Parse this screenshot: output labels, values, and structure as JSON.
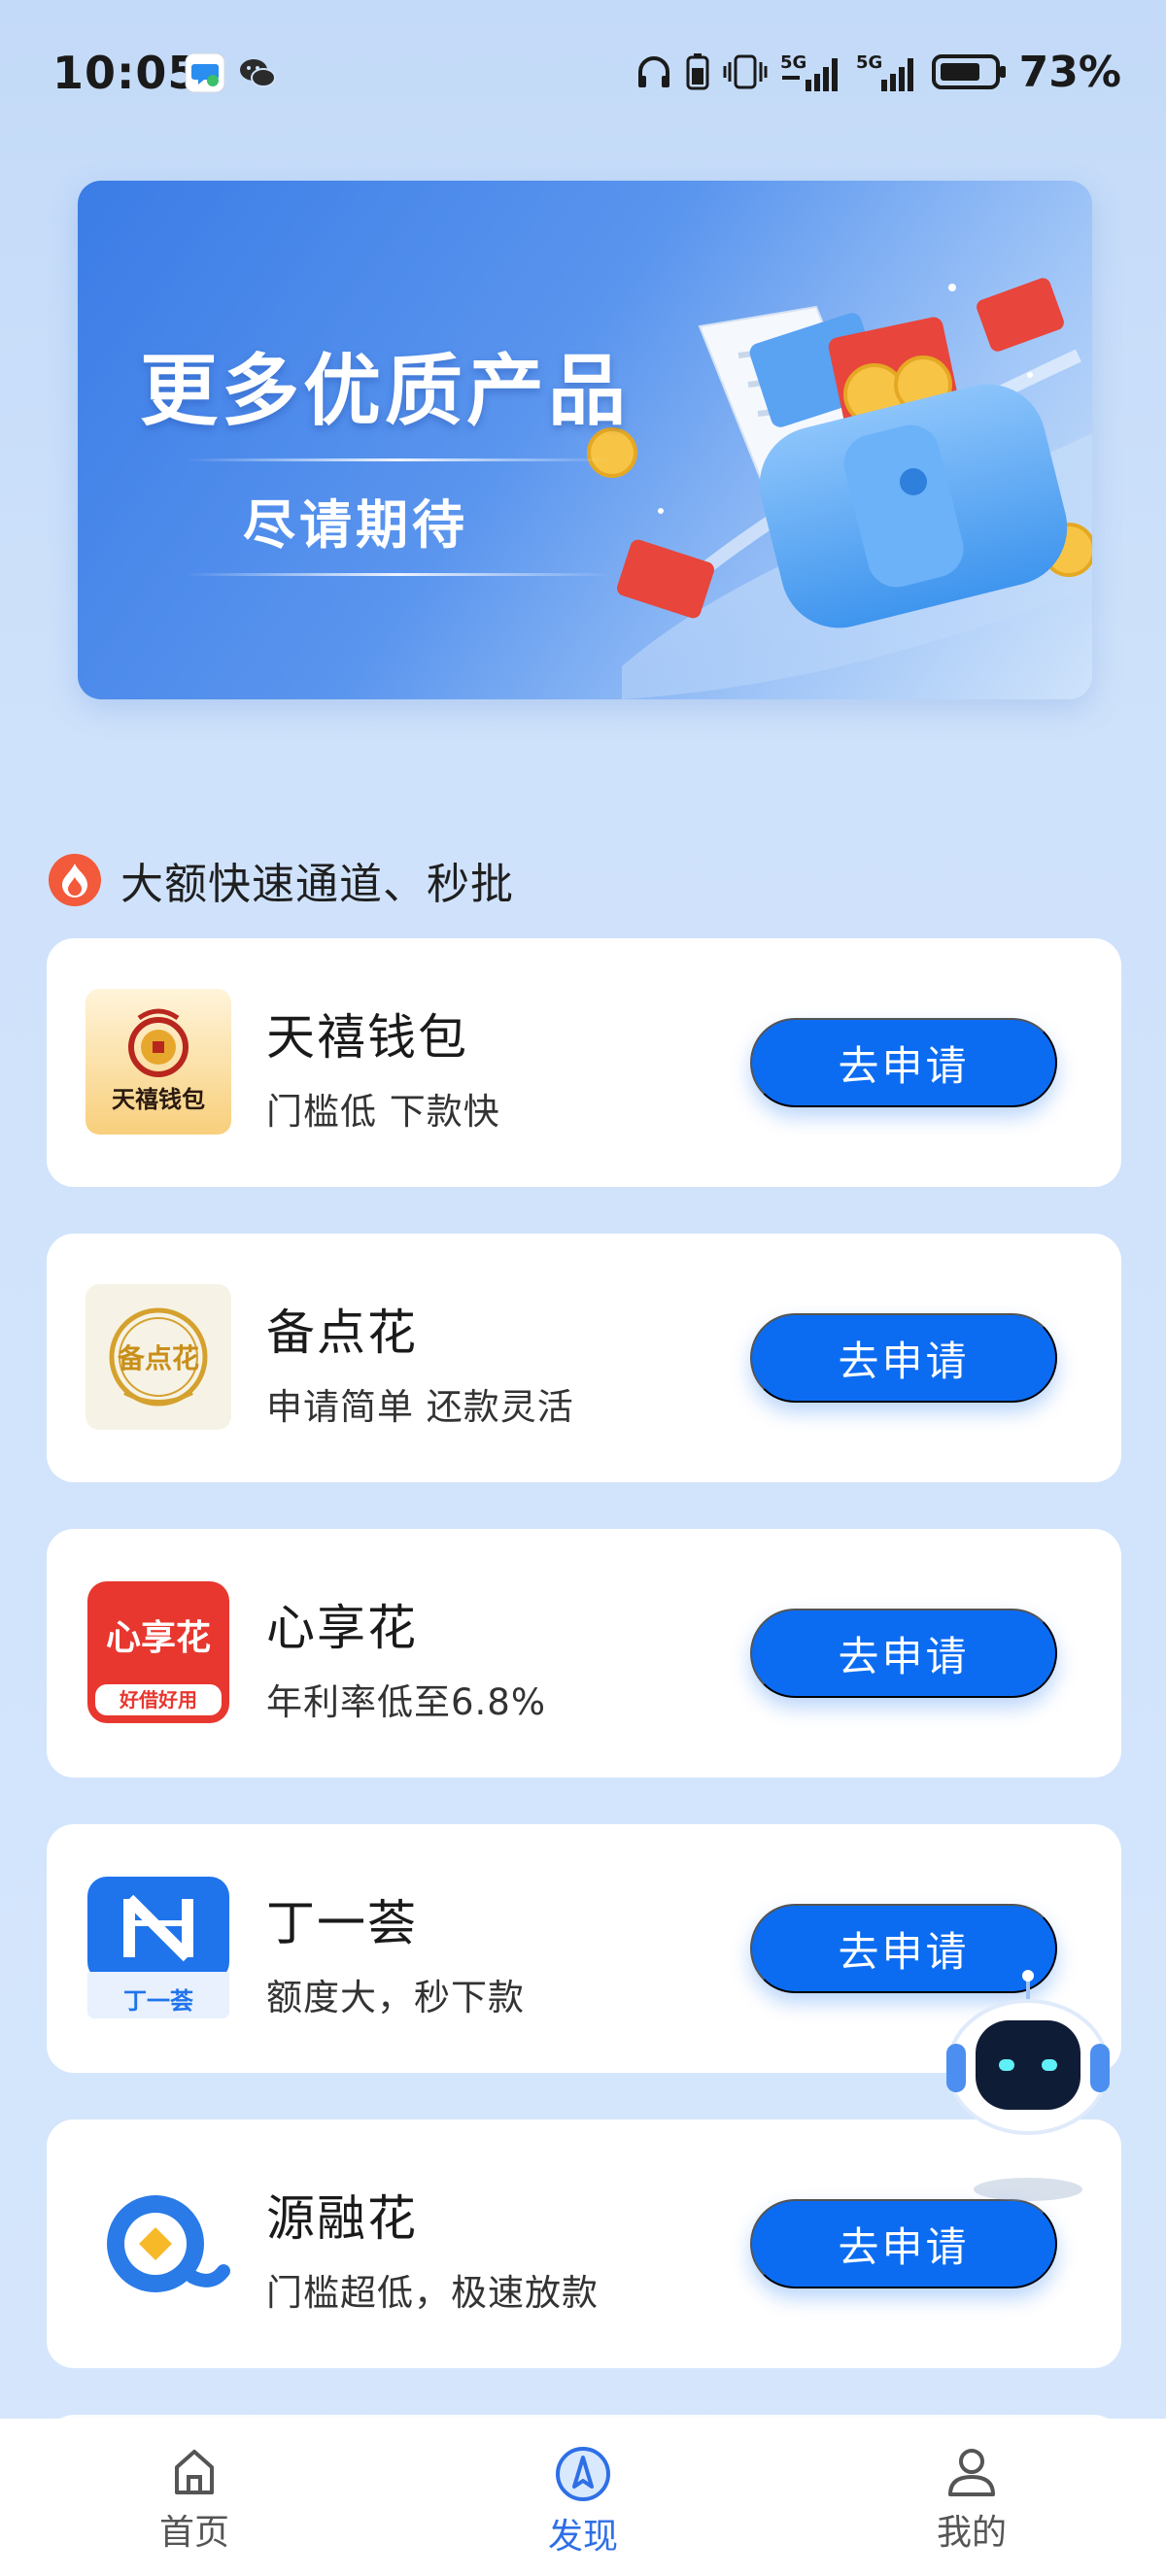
{
  "status_bar": {
    "time": "10:05",
    "battery_percent": "73%",
    "network": [
      "5G",
      "5G"
    ],
    "icons": [
      "message-app-icon",
      "wechat-icon",
      "headphones-icon",
      "battery-saver-icon",
      "vibrate-icon",
      "signal-icon",
      "signal-icon",
      "battery-icon"
    ]
  },
  "banner": {
    "title": "更多优质产品",
    "subtitle": "尽请期待"
  },
  "section": {
    "title": "大额快速通道、秒批",
    "icon": "fire-icon"
  },
  "products": [
    {
      "name": "天禧钱包",
      "desc": "门槛低 下款快",
      "button": "去申请",
      "logo_text": "天禧钱包"
    },
    {
      "name": "备点花",
      "desc": "申请简单 还款灵活",
      "button": "去申请",
      "logo_text": "备点花"
    },
    {
      "name": "心享花",
      "desc": "年利率低至6.8%",
      "button": "去申请",
      "logo_text": "心享花",
      "logo_sub": "好借好用"
    },
    {
      "name": "丁一荟",
      "desc": "额度大，秒下款",
      "button": "去申请",
      "logo_text": "丁一荟"
    },
    {
      "name": "源融花",
      "desc": "门槛超低，极速放款",
      "button": "去申请"
    }
  ],
  "nav": {
    "items": [
      {
        "label": "首页",
        "icon": "home-icon",
        "active": false
      },
      {
        "label": "发现",
        "icon": "compass-icon",
        "active": true
      },
      {
        "label": "我的",
        "icon": "user-icon",
        "active": false
      }
    ]
  },
  "colors": {
    "primary": "#0b6cf2",
    "nav_active": "#2f6fe6",
    "background": "#cfe2fb",
    "fire": "#f25a3b"
  }
}
